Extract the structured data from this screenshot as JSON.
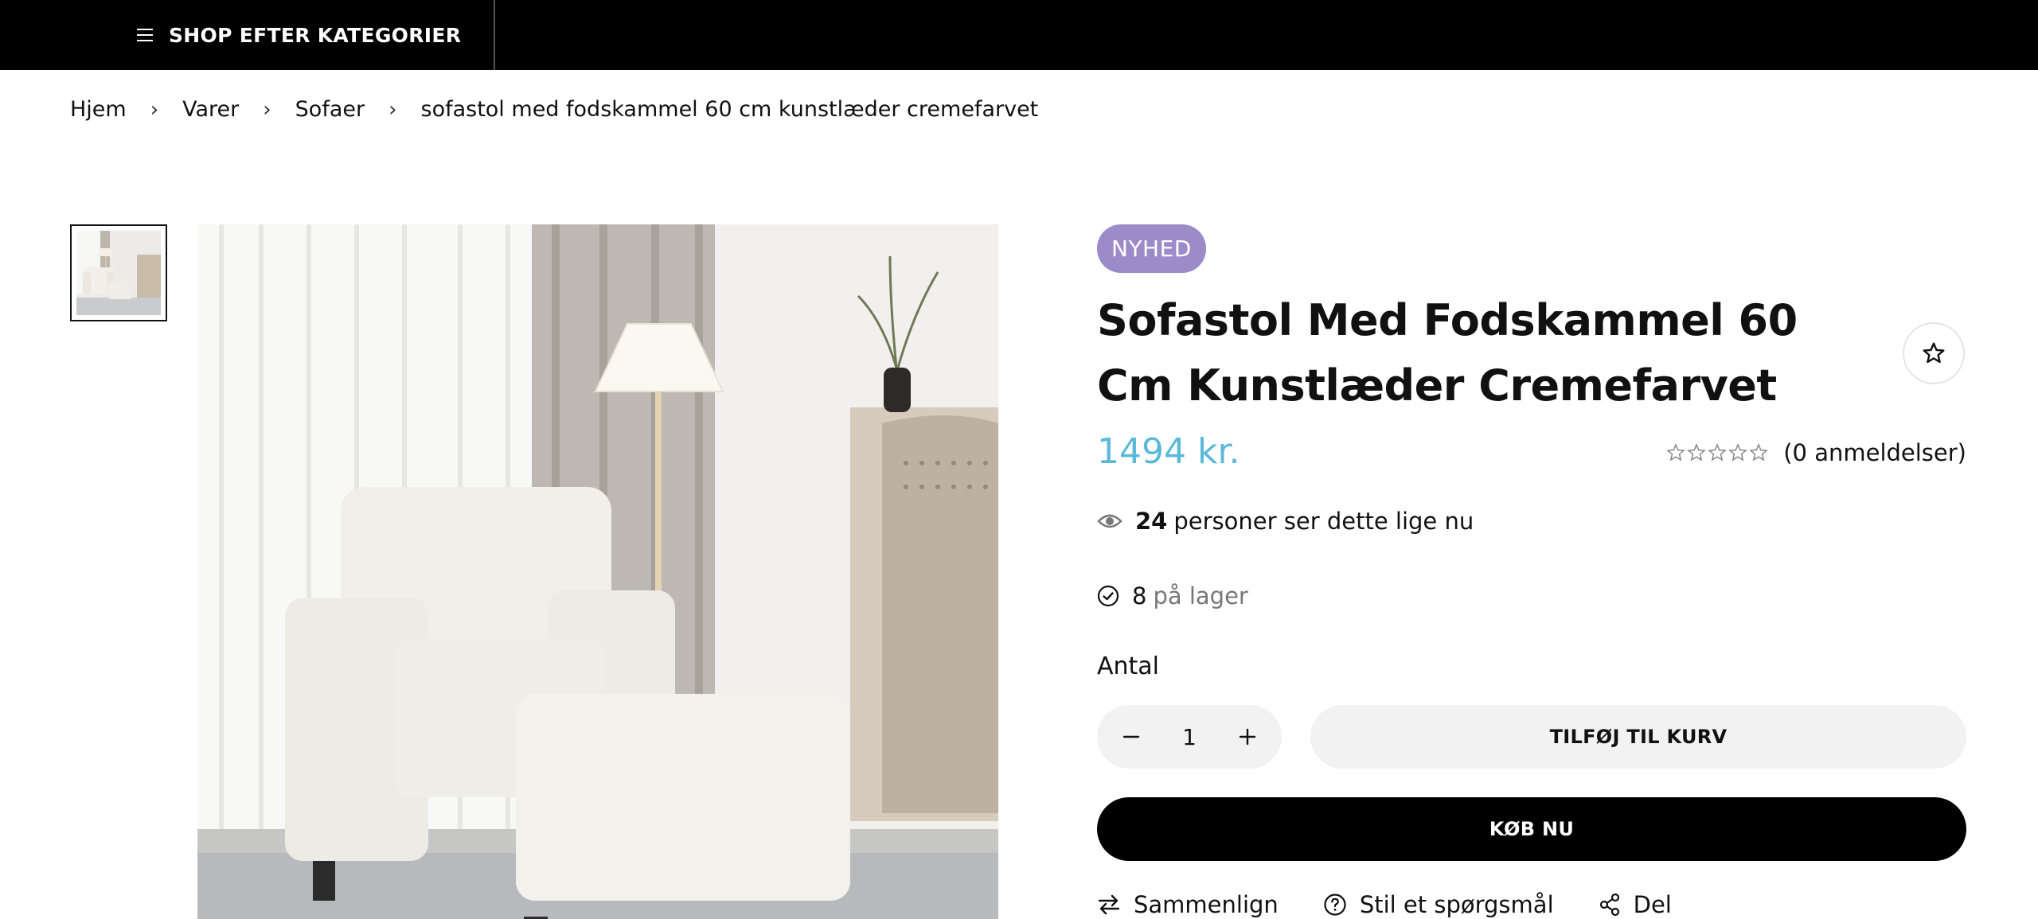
{
  "topbar": {
    "category_button_label": "SHOP EFTER KATEGORIER",
    "icon": "hamburger-menu-icon"
  },
  "breadcrumb": {
    "items": [
      "Hjem",
      "Varer",
      "Sofaer",
      "sofastol med fodskammel 60 cm kunstlæder cremefarvet"
    ],
    "separator": "›"
  },
  "product": {
    "badge": "NYHED",
    "title": "Sofastol Med Fodskammel 60 Cm Kunstlæder Cremefarvet",
    "price": "1494 kr.",
    "rating": {
      "stars_filled": 0,
      "stars_total": 5,
      "reviews_label": "(0 anmeldelser)"
    },
    "viewers": {
      "count": "24",
      "text": "personer ser dette lige nu"
    },
    "stock": {
      "count": "8",
      "text": "på lager"
    },
    "quantity_label": "Antal",
    "quantity_value": "1",
    "add_to_cart_label": "TILFØJ TIL KURV",
    "buy_now_label": "KØB NU",
    "actions": {
      "compare": "Sammenlign",
      "ask": "Stil et spørgsmål",
      "share": "Del"
    }
  },
  "colors": {
    "topbar_bg": "#000000",
    "badge_bg": "#9d8bc9",
    "price": "#5bb8d9",
    "button_light": "#f2f2f2",
    "button_dark": "#000000"
  }
}
